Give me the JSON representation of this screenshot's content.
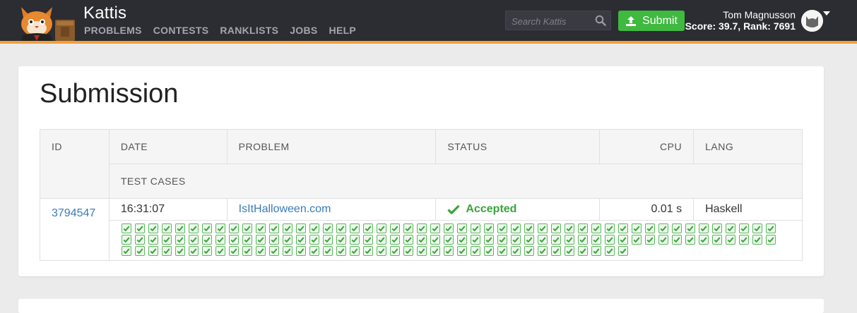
{
  "header": {
    "brand": "Kattis",
    "nav": [
      "PROBLEMS",
      "CONTESTS",
      "RANKLISTS",
      "JOBS",
      "HELP"
    ],
    "search_placeholder": "Search Kattis",
    "submit_label": "Submit",
    "user_name": "Tom Magnusson",
    "user_score": "Score: 39.7, Rank: 7691",
    "accent_color": "#f0a23a",
    "submit_color": "#3fb93f"
  },
  "page": {
    "title": "Submission"
  },
  "table": {
    "headers": {
      "id": "ID",
      "date": "DATE",
      "problem": "PROBLEM",
      "status": "STATUS",
      "cpu": "CPU",
      "lang": "LANG",
      "test_cases": "TEST CASES"
    },
    "row": {
      "id": "3794547",
      "date": "16:31:07",
      "problem": "IsItHalloween.com",
      "status": "Accepted",
      "cpu": "0.01 s",
      "lang": "Haskell"
    },
    "test_cases": {
      "passed": 136,
      "total": 136,
      "icon": "check-icon"
    }
  }
}
